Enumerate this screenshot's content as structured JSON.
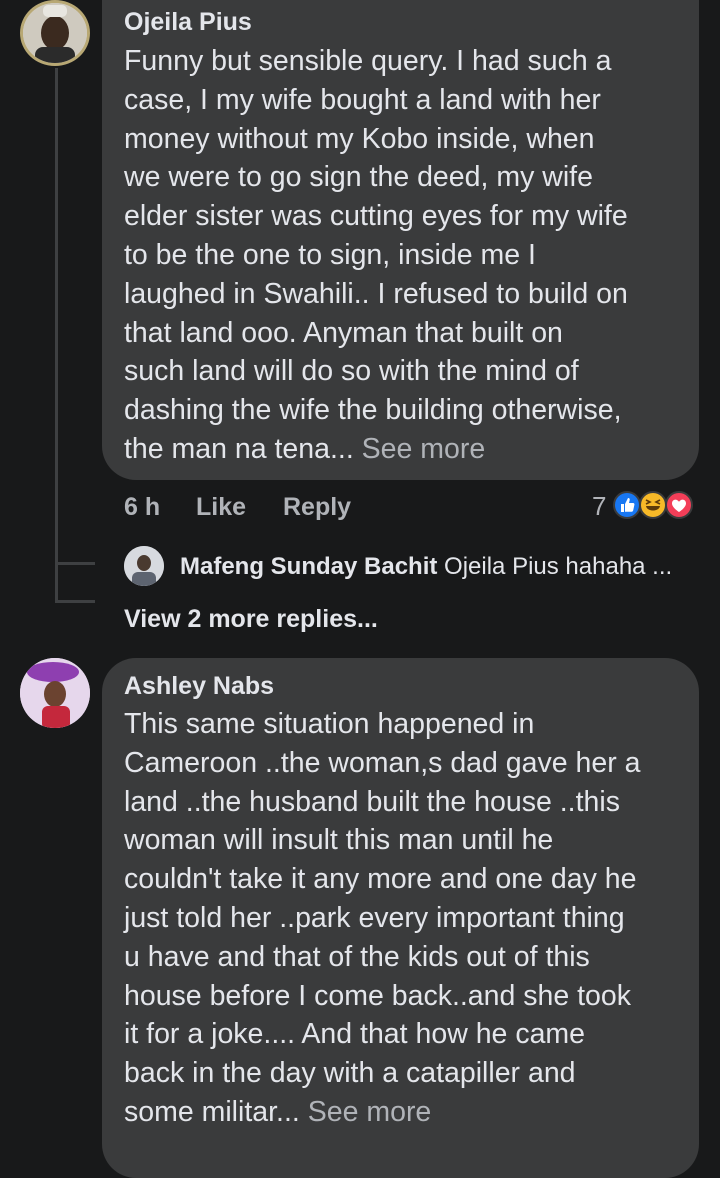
{
  "comments": [
    {
      "author": "Ojeila Pius",
      "lines": [
        "Funny but sensible query. I had such a",
        "case, I my wife bought a land with her",
        "money without my Kobo inside, when",
        "we were to go sign the deed, my wife",
        "elder sister was cutting eyes for my wife",
        "to be the one to sign, inside me I",
        "laughed in Swahili.. I refused to build on",
        "that land ooo. Anyman that built on",
        "such land will do so with the mind of",
        "dashing the wife the building otherwise,",
        "the man na tena..."
      ],
      "see_more": "See more",
      "time": "6 h",
      "like": "Like",
      "reply": "Reply",
      "reaction_count": "7",
      "reactions": [
        "like-icon",
        "haha-icon",
        "love-icon"
      ],
      "reply_preview": {
        "author": "Mafeng Sunday Bachit",
        "text": "Ojeila Pius hahaha ..."
      },
      "view_more_replies": "View 2 more replies..."
    },
    {
      "author": "Ashley Nabs",
      "lines": [
        "This same situation happened in",
        "Cameroon ..the woman,s dad gave her a",
        "land ..the husband built the house ..this",
        "woman will insult this man until he",
        "couldn't take it any more and one day he",
        "just told her ..park every important thing",
        "u have and that of the kids out of this",
        "house before I come back..and she took",
        "it for a joke.... And that how he came",
        "back in the day with a catapiller and",
        "some militar..."
      ],
      "see_more": "See more"
    }
  ],
  "colors": {
    "background": "#18191a",
    "bubble": "#3a3b3c",
    "text": "#e4e6eb",
    "secondary_text": "#b0b3b8",
    "like_blue": "#1877f2",
    "haha_yellow": "#f7b928",
    "love_red": "#f33e58"
  }
}
